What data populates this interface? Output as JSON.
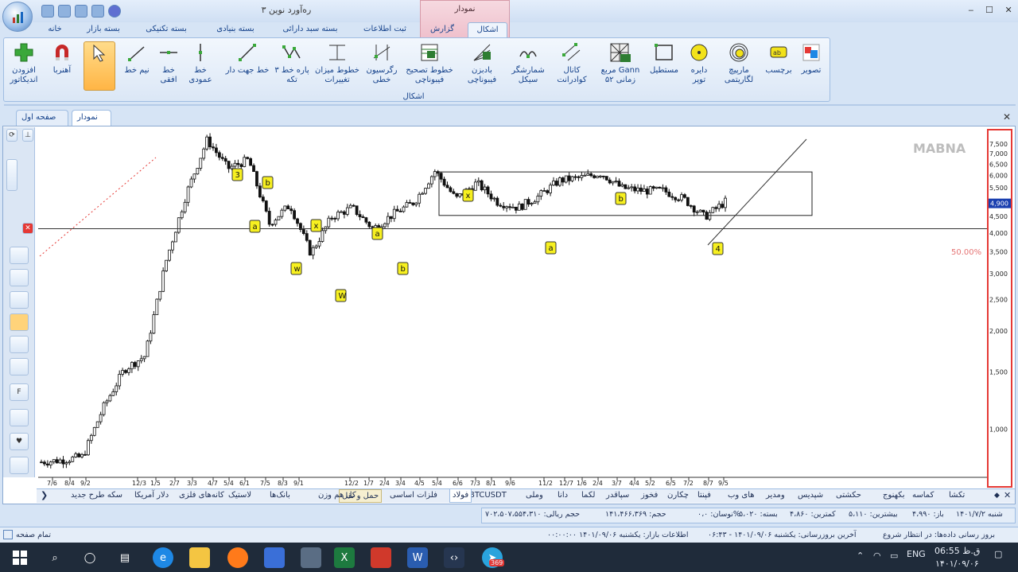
{
  "window": {
    "title": "ره‌آورد نوین ۳",
    "context_title": "نمودار",
    "minimize": "‒",
    "maximize": "☐",
    "close": "✕"
  },
  "ribbon_tabs": [
    {
      "label": "خانه"
    },
    {
      "label": "بسته بازار"
    },
    {
      "label": "بسته تکنیکی"
    },
    {
      "label": "بسته بنیادی"
    },
    {
      "label": "بسته سبد دارائی"
    },
    {
      "label": "ثبت اطلاعات"
    },
    {
      "label": "گزارش"
    },
    {
      "label": "اشکال"
    }
  ],
  "ribbon_buttons": {
    "add_indicator": "افزودن\nاندیکاتور",
    "magnet": "آهنربا",
    "pointer": "",
    "half_line": "نیم خط",
    "horizontal_line": "خط\nافقی",
    "vertical_line": "خط\nعمودی",
    "trend_line": "خط جهت دار",
    "three_point_line": "پاره خط ۳\nتکه",
    "change_level_lines": "خطوط میزان\nتغییرات",
    "linear_regression": "رگرسیون\nخطی",
    "fib_retracement": "خطوط تصحیح\nفیبوناچی",
    "fib_fan": "بادبزن\nفیبوناچی",
    "cycle_counter": "شمارشگر\nسیکل",
    "quadrant_channel": "کانال\nکوادرانت",
    "gann_square": "مربع Gann\nزمانی ۵۲",
    "rectangle": "مستطیل",
    "circle": "دایره\nتوپر",
    "log_spiral": "مارپیچ\nلگاریتمی",
    "label": "برچسب",
    "image": "تصویر"
  },
  "ribbon_group_label": "اشکال",
  "doc_tabs": {
    "first_page": "صفحه اول",
    "chart": "نمودار"
  },
  "watermark": "MABNA",
  "price_axis": {
    "labels": [
      "7,500",
      "7,000",
      "6,500",
      "6,000",
      "5,500",
      "5,000",
      "4,500",
      "4,000",
      "3,500",
      "3,000",
      "2,500",
      "2,000",
      "1,500",
      "1,000"
    ],
    "last_price": "4,900",
    "fib_level": "50.00%"
  },
  "date_axis": [
    "7/6",
    "8/4",
    "9/2",
    "12/3",
    "1/5",
    "2/7",
    "3/3",
    "4/7",
    "5/4",
    "6/1",
    "7/5",
    "8/3",
    "9/1",
    "12/2",
    "1/7",
    "2/4",
    "3/4",
    "4/5",
    "5/4",
    "6/6",
    "7/3",
    "8/1",
    "9/6",
    "11/2",
    "12/7",
    "1/6",
    "2/4",
    "3/7",
    "4/4",
    "5/2",
    "6/5",
    "7/2",
    "8/7",
    "9/5"
  ],
  "wave_labels": [
    "3",
    "b",
    "a",
    "x",
    "w",
    "W",
    "a",
    "b",
    "x",
    "a",
    "b",
    "4"
  ],
  "symbol_tabs": [
    "تکشا",
    "کماسه",
    "بکهنوج",
    "حکشتی",
    "شپدیس",
    "ومدیر",
    "های وب",
    "فپنتا",
    "چکارن",
    "فخوز",
    "سپاقدر",
    "لکما",
    "دانا",
    "وملی",
    "BTCUSDT",
    "فولاد",
    "فلزات اساسی",
    "حمل و نقل",
    "کل هم وزن",
    "بانک‌ها",
    "لاستیک",
    "کانه‌های فلزی",
    "دلار آمریکا",
    "سکه طرح جدید"
  ],
  "status": {
    "date": "شنبه ۱۴۰۱/۷/۲",
    "open": "باز: ۴،۹۹۰",
    "high": "بیشترین: ۵،۱۱۰",
    "low": "کمترین: ۴،۸۶۰",
    "close": "بسته: ۵،۰۲۰",
    "volatility": "نوسان: ۰،۰%",
    "volume": "حجم: ۱۴۱،۴۶۶،۳۶۹",
    "value": "حجم ریالی: ۷۰۲،۵۰۷،۵۵۴،۳۱۰"
  },
  "bottom_status": {
    "full_page": "تمام صفحه",
    "update_status": "بروز رسانی داده‌ها: در انتظار شروع",
    "last_update": "آخرین بروزرسانی: یکشنبه ۱۴۰۱/۰۹/۰۶ - ۰۶:۴۳",
    "market_info": "اطلاعات بازار: یکشنبه ۱۴۰۱/۰۹/۰۶ ۰۰:۰۰:۰۰"
  },
  "taskbar": {
    "lang": "ENG",
    "time": "06:55 ق.ظ",
    "date": "۱۴۰۱/۰۹/۰۶",
    "telegram_badge": "369"
  },
  "chart_data": {
    "type": "candlestick",
    "y_scale": "log",
    "ylim": [
      700,
      8200
    ],
    "approx_close_path": [
      {
        "date": "7/6",
        "close": 780
      },
      {
        "date": "8/4",
        "close": 790
      },
      {
        "date": "9/2",
        "close": 810
      },
      {
        "date": "12/3",
        "close": 1150
      },
      {
        "date": "1/5",
        "close": 1500
      },
      {
        "date": "2/7",
        "close": 1650
      },
      {
        "date": "3/3",
        "close": 3200
      },
      {
        "date": "4/7",
        "close": 5200
      },
      {
        "date": "5/4",
        "close": 7600
      },
      {
        "date": "6/1",
        "close": 6200
      },
      {
        "date": "7/5",
        "close": 6600
      },
      {
        "date": "8/3",
        "close": 4200
      },
      {
        "date": "9/1",
        "close": 4800
      },
      {
        "date": "12/2",
        "close": 3400
      },
      {
        "date": "1/7",
        "close": 4400
      },
      {
        "date": "2/4",
        "close": 4700
      },
      {
        "date": "3/4",
        "close": 4050
      },
      {
        "date": "4/5",
        "close": 4500
      },
      {
        "date": "5/4",
        "close": 4900
      },
      {
        "date": "6/6",
        "close": 6100
      },
      {
        "date": "7/3",
        "close": 5000
      },
      {
        "date": "8/1",
        "close": 5600
      },
      {
        "date": "9/6",
        "close": 4900
      },
      {
        "date": "11/2",
        "close": 4700
      },
      {
        "date": "12/7",
        "close": 5100
      },
      {
        "date": "1/6",
        "close": 5700
      },
      {
        "date": "2/4",
        "close": 5800
      },
      {
        "date": "3/7",
        "close": 6000
      },
      {
        "date": "4/4",
        "close": 5400
      },
      {
        "date": "5/2",
        "close": 5300
      },
      {
        "date": "6/5",
        "close": 5300
      },
      {
        "date": "7/2",
        "close": 5000
      },
      {
        "date": "8/7",
        "close": 4400
      },
      {
        "date": "9/5",
        "close": 4900
      }
    ],
    "horizontal_line": 4050,
    "rectangle": {
      "top": 6050,
      "bottom": 4450
    },
    "fib_label": "50.00%"
  }
}
